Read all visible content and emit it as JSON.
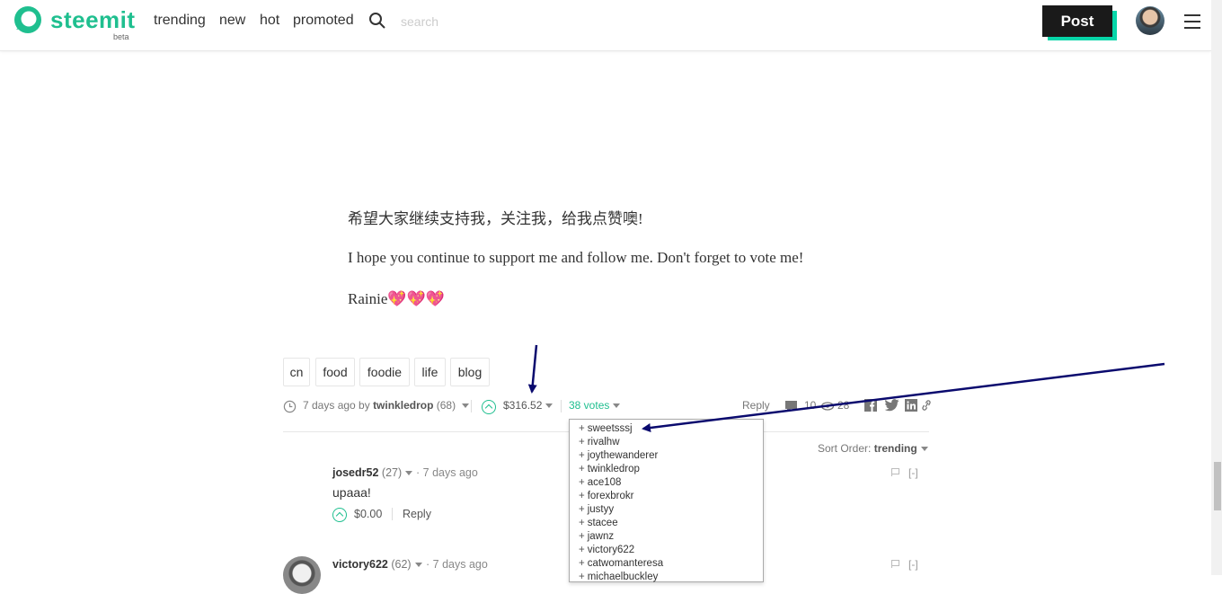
{
  "header": {
    "brand": "steemit",
    "beta": "beta",
    "nav": [
      "trending",
      "new",
      "hot",
      "promoted"
    ],
    "search_placeholder": "search",
    "post_label": "Post",
    "accent_color": "#1fbf8f"
  },
  "article": {
    "para_cn": "希望大家继续支持我，关注我，给我点赞噢!",
    "para_en": "I hope you continue to support me and follow me. Don't forget to vote me!",
    "signature": "Rainie💖💖💖",
    "tags": [
      "cn",
      "food",
      "foodie",
      "life",
      "blog"
    ]
  },
  "meta": {
    "time": "7 days ago by",
    "author": "twinkledrop",
    "reputation": "(68)",
    "payout": "$316.52",
    "votes": "38 votes",
    "reply": "Reply",
    "comments_count": "10",
    "views_count": "28"
  },
  "voters": [
    "sweetsssj",
    "rivalhw",
    "joythewanderer",
    "twinkledrop",
    "ace108",
    "forexbrokr",
    "justyy",
    "stacee",
    "jawnz",
    "victory622",
    "catwomanteresa",
    "michaelbuckley"
  ],
  "sort": {
    "label": "Sort Order:",
    "value": "trending"
  },
  "comments": [
    {
      "author": "josedr52",
      "rep": "(27)",
      "time": "7 days ago",
      "body": "upaaa!",
      "payout": "$0.00",
      "reply": "Reply",
      "collapse": "[-]"
    },
    {
      "author": "victory622",
      "rep": "(62)",
      "time": "7 days ago",
      "collapse": "[-]"
    }
  ]
}
